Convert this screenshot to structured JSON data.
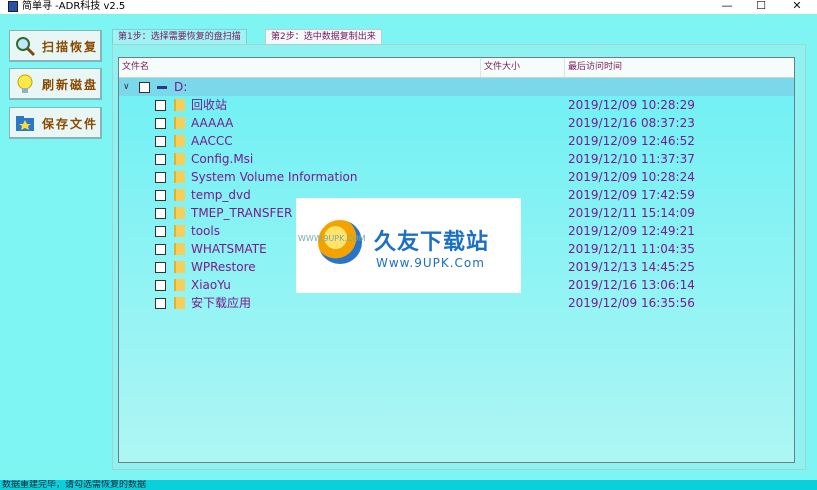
{
  "window": {
    "title": "简单寻   -ADR科技 v2.5",
    "minimize": "—",
    "maximize": "☐",
    "close": "✕"
  },
  "sidebar": {
    "buttons": [
      {
        "label": "扫描恢复",
        "icon": "magnifier-icon"
      },
      {
        "label": "刷新磁盘",
        "icon": "lightbulb-icon"
      },
      {
        "label": "保存文件",
        "icon": "save-folder-icon"
      }
    ]
  },
  "tabs": [
    {
      "label": "第1步：选择需要恢复的盘扫描"
    },
    {
      "label": "第2步：选中数据复制出来"
    }
  ],
  "list": {
    "columns": {
      "name": "文件名",
      "size": "文件大小",
      "time": "最后访问时间"
    },
    "drive": {
      "label": "D:",
      "expander": "∨"
    },
    "rows": [
      {
        "name": "回收站",
        "time": "2019/12/09 10:28:29"
      },
      {
        "name": "AAAAA",
        "time": "2019/12/16 08:37:23"
      },
      {
        "name": "AACCC",
        "time": "2019/12/09 12:46:52"
      },
      {
        "name": "Config.Msi",
        "time": "2019/12/10 11:37:37"
      },
      {
        "name": "System Volume Information",
        "time": "2019/12/09 10:28:24"
      },
      {
        "name": "temp_dvd",
        "time": "2019/12/09 17:42:59"
      },
      {
        "name": "TMEP_TRANSFER",
        "time": "2019/12/11 15:14:09"
      },
      {
        "name": "tools",
        "time": "2019/12/09 12:49:21"
      },
      {
        "name": "WHATSMATE",
        "time": "2019/12/11 11:04:35"
      },
      {
        "name": "WPRestore",
        "time": "2019/12/13 14:45:25"
      },
      {
        "name": "XiaoYu",
        "time": "2019/12/16 13:06:14"
      },
      {
        "name": "安下载应用",
        "time": "2019/12/09 16:35:56"
      }
    ]
  },
  "watermark": {
    "brand": "久友下载站",
    "url": "Www.9UPK.Com",
    "side": "WWW.9UPK.COM"
  },
  "status": {
    "text": "数据重建完毕，请勾选需恢复的数据"
  }
}
